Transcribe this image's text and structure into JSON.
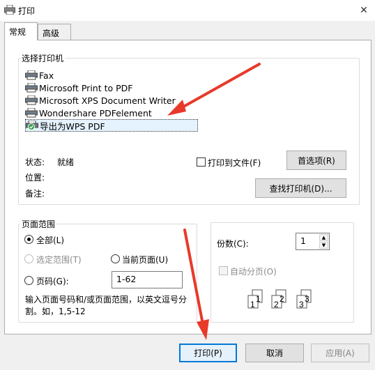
{
  "window": {
    "title": "打印",
    "close": "✕"
  },
  "tabs": [
    {
      "label": "常规",
      "active": true
    },
    {
      "label": "高级",
      "active": false
    }
  ],
  "select_printer": {
    "legend": "选择打印机",
    "printers": [
      {
        "name": "Fax"
      },
      {
        "name": "Microsoft Print to PDF"
      },
      {
        "name": "Microsoft XPS Document Writer"
      },
      {
        "name": "Wondershare PDFelement"
      },
      {
        "name": "导出为WPS PDF",
        "selected": true
      }
    ],
    "status_label": "状态:",
    "status_value": "就绪",
    "location_label": "位置:",
    "location_value": "",
    "comment_label": "备注:",
    "comment_value": "",
    "print_to_file": "打印到文件(F)",
    "preferences": "首选项(R)",
    "find_printer": "查找打印机(D)..."
  },
  "page_range": {
    "legend": "页面范围",
    "all": "全部(L)",
    "selection": "选定范围(T)",
    "current_page": "当前页面(U)",
    "pages": "页码(G):",
    "pages_value": "1-62",
    "hint": "输入页面号码和/或页面范围，以英文逗号分割。如，1,5-12"
  },
  "copies": {
    "label": "份数(C):",
    "value": "1",
    "collate": "自动分页(O)",
    "collate_icons": [
      "1",
      "1",
      "2",
      "2",
      "3",
      "3"
    ]
  },
  "footer": {
    "print": "打印(P)",
    "cancel": "取消",
    "apply": "应用(A)"
  },
  "colors": {
    "accent": "#0078d7",
    "arrow": "#e8392a",
    "selected_bg": "#e5f3ff"
  }
}
